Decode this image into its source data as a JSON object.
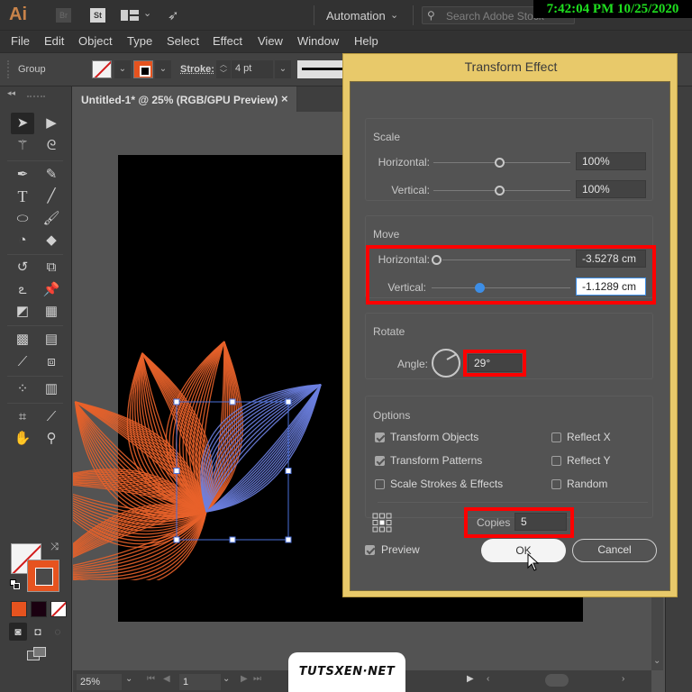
{
  "app": {
    "logo": "Ai",
    "bridge_label": "Br",
    "stock_label": "St",
    "workspace": "Automation",
    "stock_search_placeholder": "Search Adobe Stock",
    "clock": "7:42:04 PM 10/25/2020"
  },
  "menu": [
    "File",
    "Edit",
    "Object",
    "Type",
    "Select",
    "Effect",
    "View",
    "Window",
    "Help"
  ],
  "control_bar": {
    "selection_label": "Group",
    "stroke_label": "Stroke:",
    "stroke_weight": "4 pt",
    "fill_color": "none",
    "stroke_color": "#e6531f"
  },
  "document": {
    "tab_title": "Untitled-1* @ 25% (RGB/GPU Preview)",
    "close_glyph": "×",
    "zoom": "25%",
    "artboard_number": "1"
  },
  "toolbar": {
    "tools": [
      "selection-tool",
      "direct-selection-tool",
      "magic-wand-tool",
      "lasso-tool",
      "pen-tool",
      "curvature-tool",
      "type-tool",
      "line-segment-tool",
      "ellipse-tool",
      "paintbrush-tool",
      "shaper-tool",
      "eraser-tool",
      "rotate-tool",
      "scale-tool",
      "warp-tool",
      "puppet-warp-tool",
      "shape-builder-tool",
      "perspective-grid-tool",
      "mesh-tool",
      "gradient-tool",
      "eyedropper-tool",
      "blend-tool",
      "symbol-sprayer-tool",
      "column-graph-tool",
      "artboard-tool",
      "slice-tool",
      "hand-tool",
      "zoom-tool"
    ],
    "swatches": [
      "#e6531f",
      "#1a0010",
      "none"
    ]
  },
  "dialog": {
    "title": "Transform Effect",
    "scale": {
      "label": "Scale",
      "horizontal_label": "Horizontal:",
      "horizontal_value": "100%",
      "vertical_label": "Vertical:",
      "vertical_value": "100%"
    },
    "move": {
      "label": "Move",
      "horizontal_label": "Horizontal:",
      "horizontal_value": "-3.5278 cm",
      "vertical_label": "Vertical:",
      "vertical_value": "-1.1289 cm"
    },
    "rotate": {
      "label": "Rotate",
      "angle_label": "Angle:",
      "angle_value": "29°"
    },
    "options": {
      "label": "Options",
      "transform_objects": {
        "label": "Transform Objects",
        "checked": true
      },
      "transform_patterns": {
        "label": "Transform Patterns",
        "checked": true
      },
      "scale_strokes": {
        "label": "Scale Strokes & Effects",
        "checked": false
      },
      "reflect_x": {
        "label": "Reflect X",
        "checked": false
      },
      "reflect_y": {
        "label": "Reflect Y",
        "checked": false
      },
      "random": {
        "label": "Random",
        "checked": false
      },
      "copies_label": "Copies",
      "copies_value": "5"
    },
    "preview": {
      "label": "Preview",
      "checked": true
    },
    "ok_label": "OK",
    "cancel_label": "Cancel"
  },
  "watermark": "TUTSXEN·NET",
  "colors": {
    "art_orange": "#e8622a",
    "art_blue": "#6b7fe0",
    "selection_blue": "#4a6fd8",
    "highlight_red": "#ff0000",
    "dialog_frame": "#e8c96a"
  }
}
